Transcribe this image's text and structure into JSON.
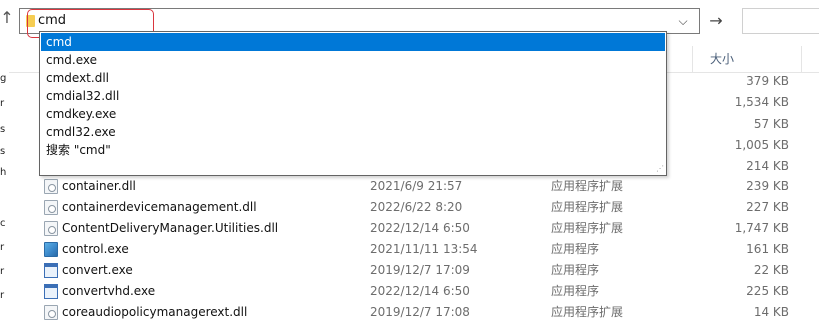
{
  "address_bar": {
    "value": "cmd",
    "chevron_icon": "chevron-down-icon",
    "go_icon": "arrow-right-icon",
    "up_icon": "arrow-up-icon",
    "folder_icon": "folder-icon"
  },
  "autocomplete": {
    "items": [
      {
        "label": "cmd",
        "selected": true
      },
      {
        "label": "cmd.exe",
        "selected": false
      },
      {
        "label": "cmdext.dll",
        "selected": false
      },
      {
        "label": "cmdial32.dll",
        "selected": false
      },
      {
        "label": "cmdkey.exe",
        "selected": false
      },
      {
        "label": "cmdl32.exe",
        "selected": false
      },
      {
        "label": "搜索 \"cmd\"",
        "selected": false
      }
    ],
    "selected_color": "#0078d7"
  },
  "nav_pane_fragments": [
    "s",
    "g",
    "r",
    "s",
    "h",
    "c",
    "r",
    "r",
    "r"
  ],
  "columns": {
    "size_label": "大小"
  },
  "hidden_sizes": [
    "379 KB",
    "1,534 KB",
    "57 KB",
    "1,005 KB",
    "214 KB"
  ],
  "files": [
    {
      "name": "container.dll",
      "date": "2021/6/9 21:57",
      "type": "应用程序扩展",
      "size": "239 KB",
      "icon": "dll-icon"
    },
    {
      "name": "containerdevicemanagement.dll",
      "date": "2022/6/22 8:20",
      "type": "应用程序扩展",
      "size": "227 KB",
      "icon": "dll-icon"
    },
    {
      "name": "ContentDeliveryManager.Utilities.dll",
      "date": "2022/12/14 6:50",
      "type": "应用程序扩展",
      "size": "1,747 KB",
      "icon": "dll-icon"
    },
    {
      "name": "control.exe",
      "date": "2021/11/11 13:54",
      "type": "应用程序",
      "size": "161 KB",
      "icon": "control-panel-icon"
    },
    {
      "name": "convert.exe",
      "date": "2019/12/7 17:09",
      "type": "应用程序",
      "size": "22 KB",
      "icon": "exe-icon"
    },
    {
      "name": "convertvhd.exe",
      "date": "2022/12/14 6:50",
      "type": "应用程序",
      "size": "225 KB",
      "icon": "exe-icon"
    },
    {
      "name": "coreaudiopolicymanagerext.dll",
      "date": "2019/12/7 17:08",
      "type": "应用程序扩展",
      "size": "14 KB",
      "icon": "dll-icon"
    }
  ]
}
